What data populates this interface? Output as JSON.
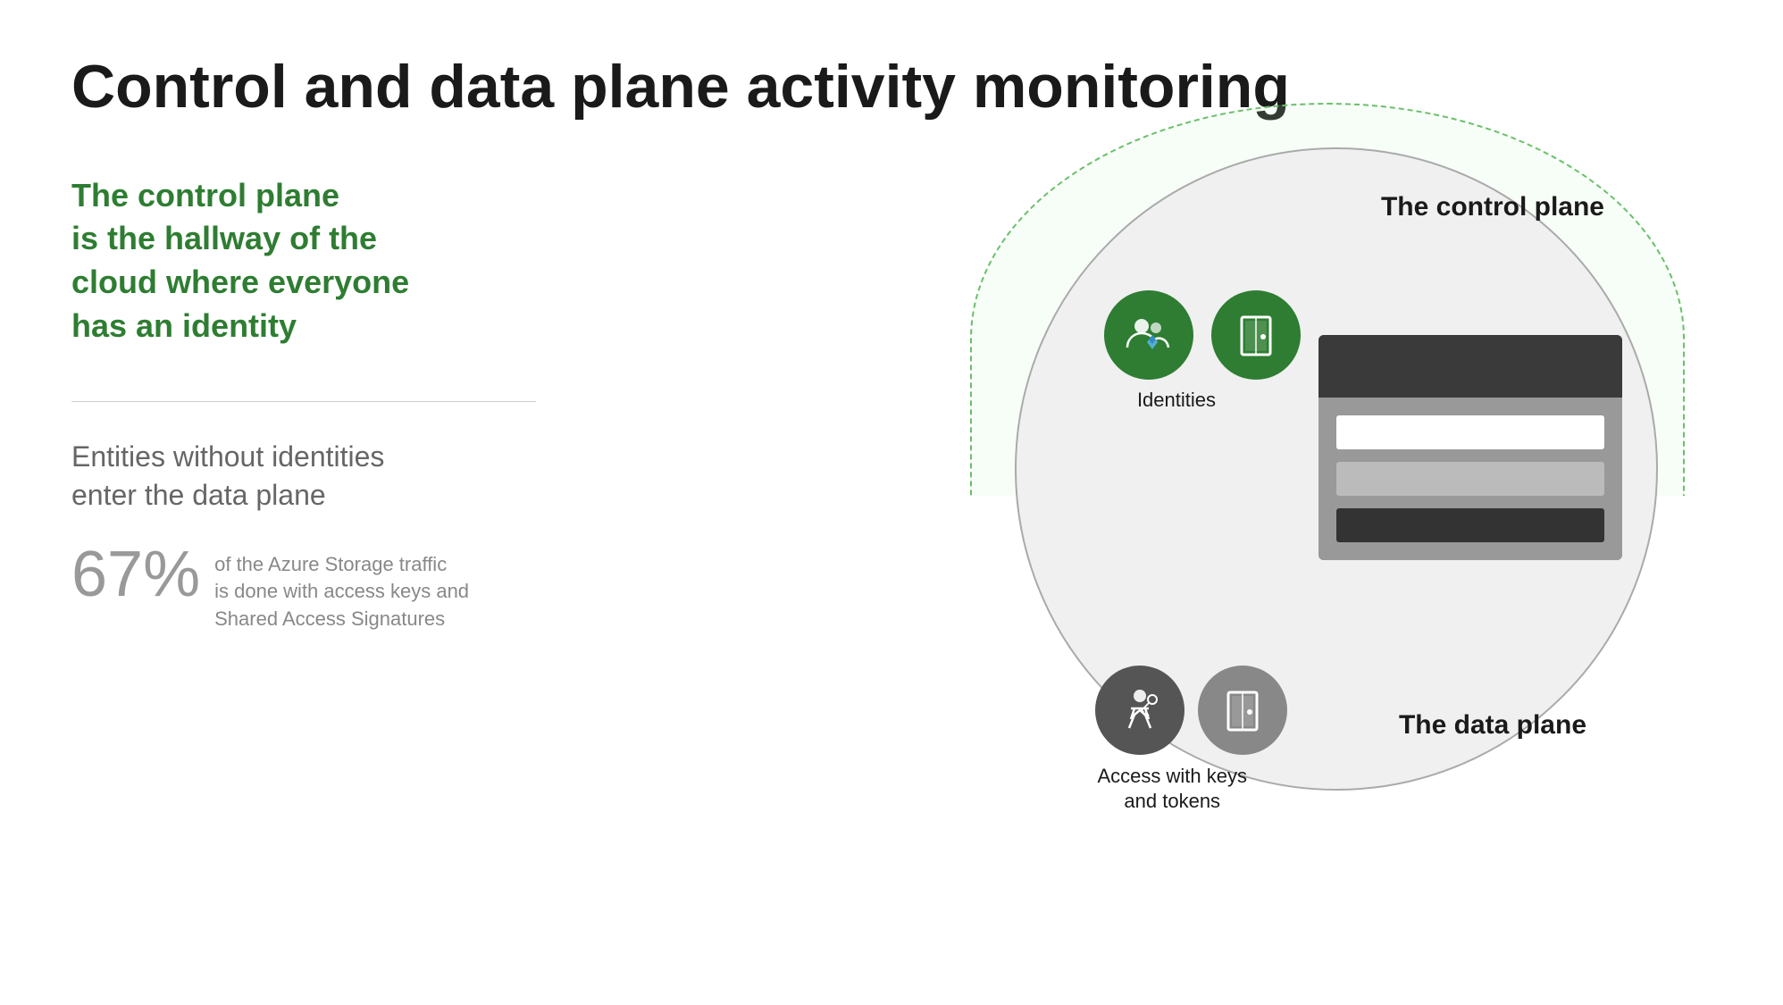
{
  "title": "Control and data plane activity monitoring",
  "green_block": {
    "line1": "The control plane",
    "line2": "is the hallway of the",
    "line3": "cloud where everyone",
    "line4": "has an identity"
  },
  "gray_block": {
    "heading_line1": "Entities without identities",
    "heading_line2": "enter the data plane"
  },
  "stat": {
    "number": "67%",
    "desc_line1": "of the Azure Storage traffic",
    "desc_line2": "is done with access keys and",
    "desc_line3": "Shared Access Signatures"
  },
  "diagram": {
    "control_plane_label": "The control plane",
    "data_plane_label": "The data plane",
    "identities_label": "Identities",
    "access_label_line1": "Access with keys",
    "access_label_line2": "and tokens"
  }
}
